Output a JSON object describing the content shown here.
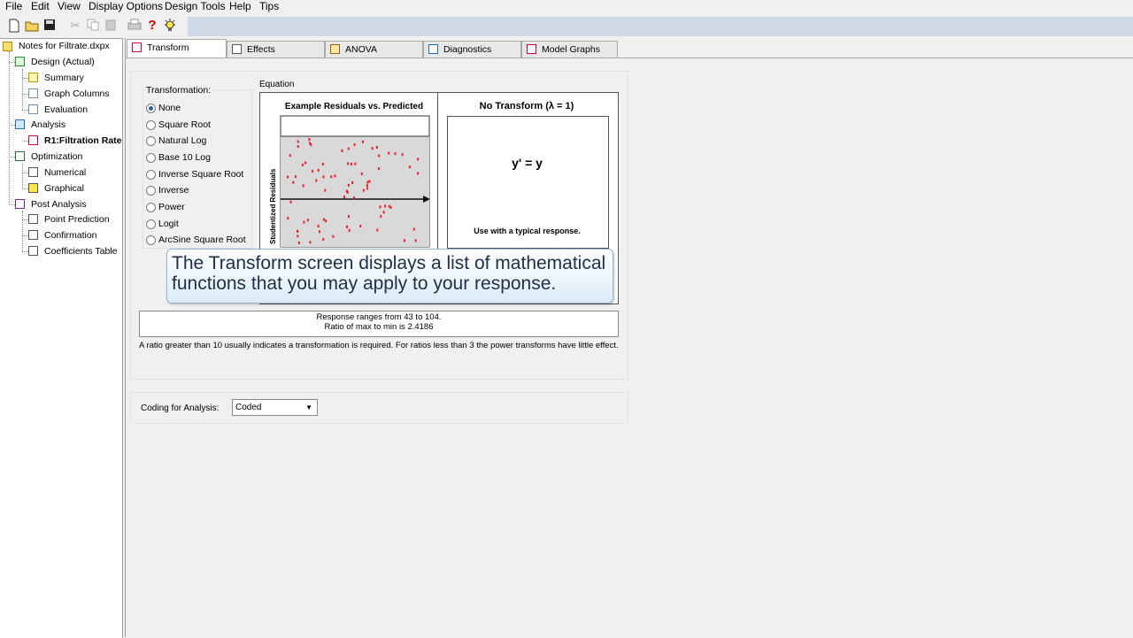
{
  "menu": [
    "File",
    "Edit",
    "View",
    "Display Options",
    "Design Tools",
    "Help",
    "Tips"
  ],
  "tree": {
    "root": "Notes for Filtrate.dxpx",
    "design": "Design (Actual)",
    "summary": "Summary",
    "graph_columns": "Graph Columns",
    "evaluation": "Evaluation",
    "analysis": "Analysis",
    "r1": "R1:Filtration Rate",
    "optimization": "Optimization",
    "numerical": "Numerical",
    "graphical": "Graphical",
    "post_analysis": "Post Analysis",
    "point_prediction": "Point Prediction",
    "confirmation": "Confirmation",
    "coefficients_table": "Coefficients Table"
  },
  "tabs": [
    "Transform",
    "Effects",
    "ANOVA",
    "Diagnostics",
    "Model Graphs"
  ],
  "transformation": {
    "label": "Transformation:",
    "options": [
      "None",
      "Square Root",
      "Natural Log",
      "Base 10 Log",
      "Inverse Square Root",
      "Inverse",
      "Power",
      "Logit",
      "ArcSine Square Root"
    ],
    "selected": "None"
  },
  "equation": {
    "label": "Equation",
    "plot_title": "Example Residuals vs. Predicted",
    "yaxis": "Studentized Residuals",
    "no_transform_title": "No Transform (λ = 1)",
    "formula": "y' = y",
    "note": "Use with a typical response."
  },
  "tooltip": {
    "line1": "The Transform screen displays a list of mathematical",
    "line2": "functions that you may apply to your response."
  },
  "ranges": {
    "line1": "Response ranges from 43 to 104.",
    "line2": "Ratio of max to min is 2.4186"
  },
  "advice": "A ratio greater than 10 usually indicates a transformation is required.  For ratios less than 3 the power transforms have little effect.",
  "coding": {
    "label": "Coding for Analysis:",
    "value": "Coded"
  },
  "colors": {
    "points": "#e8202a",
    "toolbar_fill": "#cfd9e8",
    "tooltip_text": "#1f2f46"
  }
}
